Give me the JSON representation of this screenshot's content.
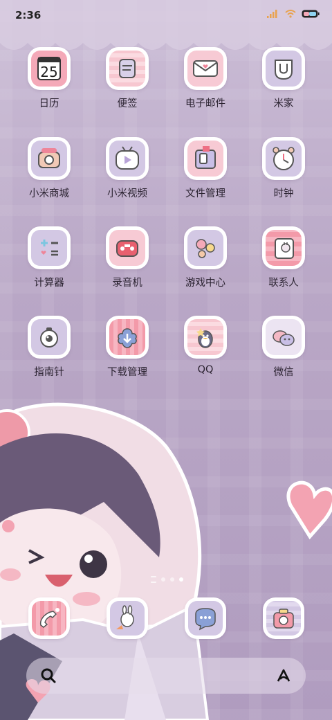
{
  "status_bar": {
    "time": "2:36"
  },
  "apps": [
    {
      "label": "日历",
      "icon": "calendar-icon",
      "badge": "25"
    },
    {
      "label": "便签",
      "icon": "notes-icon"
    },
    {
      "label": "电子邮件",
      "icon": "email-icon"
    },
    {
      "label": "米家",
      "icon": "mijia-icon"
    },
    {
      "label": "小米商城",
      "icon": "mi-store-icon"
    },
    {
      "label": "小米视频",
      "icon": "mi-video-icon"
    },
    {
      "label": "文件管理",
      "icon": "file-manager-icon"
    },
    {
      "label": "时钟",
      "icon": "clock-icon"
    },
    {
      "label": "计算器",
      "icon": "calculator-icon"
    },
    {
      "label": "录音机",
      "icon": "recorder-icon"
    },
    {
      "label": "游戏中心",
      "icon": "game-center-icon"
    },
    {
      "label": "联系人",
      "icon": "contacts-icon"
    },
    {
      "label": "指南针",
      "icon": "compass-icon"
    },
    {
      "label": "下载管理",
      "icon": "download-manager-icon"
    },
    {
      "label": "QQ",
      "icon": "qq-icon"
    },
    {
      "label": "微信",
      "icon": "wechat-icon"
    }
  ],
  "dock": [
    {
      "icon": "phone-icon"
    },
    {
      "icon": "messages-icon"
    },
    {
      "icon": "chat-bubble-icon"
    },
    {
      "icon": "camera-icon"
    }
  ],
  "pager": {
    "pages": 3,
    "current": 3
  },
  "colors": {
    "pink": "#f4a9b8",
    "lavender": "#cbbde0",
    "wall": "#b9a7c6"
  }
}
